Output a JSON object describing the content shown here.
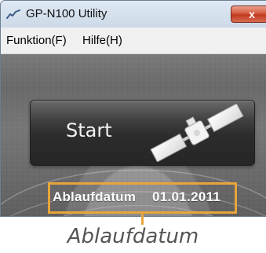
{
  "window": {
    "title": "GP-N100 Utility",
    "close_label": "x"
  },
  "menu": {
    "items": [
      {
        "label": "Funktion(F)"
      },
      {
        "label": "Hilfe(H)"
      }
    ]
  },
  "main": {
    "start_label": "Start",
    "expiry_label": "Ablaufdatum",
    "expiry_date": "01.01.2011"
  },
  "annotation": {
    "caption": "Ablaufdatum"
  },
  "colors": {
    "highlight": "#e7a53a",
    "button_dark": "#2c2c2c",
    "close_button": "#c13b21"
  },
  "icons": {
    "app": "gps-track-icon",
    "start": "satellite-icon",
    "close": "close-icon"
  }
}
